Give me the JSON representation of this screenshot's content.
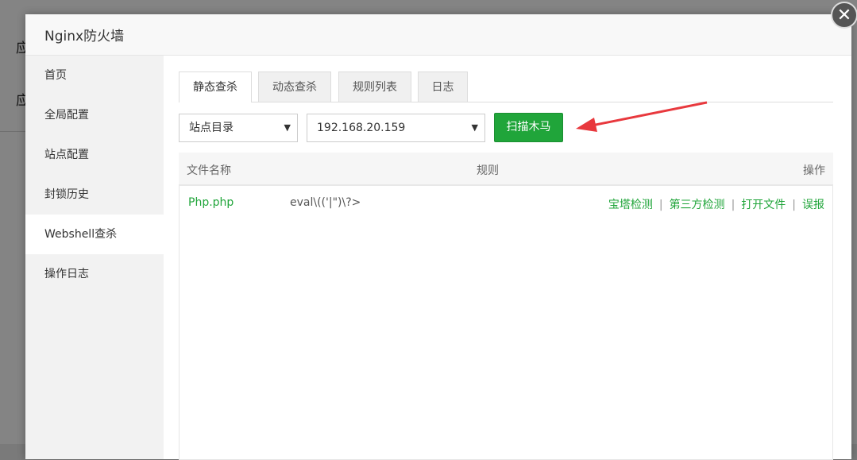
{
  "background": {
    "text1": "应",
    "text2": "应"
  },
  "dialog": {
    "title": "Nginx防火墙",
    "close_icon": "close-icon"
  },
  "sidebar": {
    "items": [
      {
        "label": "首页"
      },
      {
        "label": "全局配置"
      },
      {
        "label": "站点配置"
      },
      {
        "label": "封锁历史"
      },
      {
        "label": "Webshell查杀",
        "active": true
      },
      {
        "label": "操作日志"
      }
    ]
  },
  "tabs": [
    {
      "label": "静态查杀",
      "active": true
    },
    {
      "label": "动态查杀"
    },
    {
      "label": "规则列表"
    },
    {
      "label": "日志"
    }
  ],
  "filters": {
    "scope_select": "站点目录",
    "site_select": "192.168.20.159",
    "scan_button": "扫描木马"
  },
  "table": {
    "headers": {
      "file_name": "文件名称",
      "rule": "规则",
      "action": "操作"
    },
    "rows": [
      {
        "file_name": "Php.php",
        "rule": "eval\\(('|\")\\?>",
        "actions": [
          "宝塔检测",
          "第三方检测",
          "打开文件",
          "误报"
        ]
      }
    ]
  },
  "colors": {
    "accent": "#20a53a",
    "arrow": "#e8383d"
  }
}
